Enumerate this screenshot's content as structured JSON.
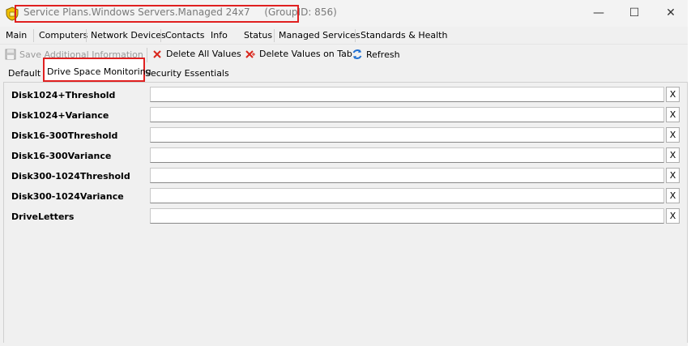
{
  "window": {
    "title": "Service Plans.Windows Servers.Managed 24x7",
    "group_id": "(GroupID: 856)",
    "minimize_glyph": "—",
    "maximize_glyph": "☐",
    "close_glyph": "✕"
  },
  "menu": {
    "items": [
      "Main",
      "Computers",
      "Network Devices",
      "Contacts",
      "Info",
      "Status",
      "Managed Services",
      "Standards & Health"
    ]
  },
  "toolbar": {
    "save_label": "Save Additional Information",
    "delete_all_label": "Delete All Values",
    "delete_tab_label": "Delete Values on Tab",
    "refresh_label": "Refresh"
  },
  "subtabs": {
    "items": [
      "Default",
      "Drive Space Monitoring",
      "Security Essentials"
    ]
  },
  "fields": [
    {
      "label": "Disk1024+Threshold",
      "value": "",
      "clear": "X"
    },
    {
      "label": "Disk1024+Variance",
      "value": "",
      "clear": "X"
    },
    {
      "label": "Disk16-300Threshold",
      "value": "",
      "clear": "X"
    },
    {
      "label": "Disk16-300Variance",
      "value": "",
      "clear": "X"
    },
    {
      "label": "Disk300-1024Threshold",
      "value": "",
      "clear": "X"
    },
    {
      "label": "Disk300-1024Variance",
      "value": "",
      "clear": "X"
    },
    {
      "label": "DriveLetters",
      "value": "",
      "clear": "X"
    }
  ],
  "colors": {
    "highlight": "#e02020",
    "delete_icon": "#d9261c",
    "refresh_icon": "#1f6fd1",
    "disabled_text": "#9a9a9a"
  }
}
